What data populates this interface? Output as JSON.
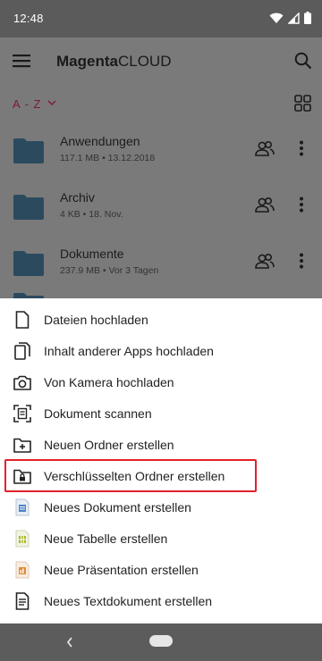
{
  "status_bar": {
    "time": "12:48"
  },
  "app_bar": {
    "title_bold": "Magenta",
    "title_rest": "CLOUD"
  },
  "sort": {
    "label": "A - Z"
  },
  "files": [
    {
      "name": "Anwendungen",
      "meta": "117.1 MB • 13.12.2018"
    },
    {
      "name": "Archiv",
      "meta": "4 KB • 18. Nov."
    },
    {
      "name": "Dokumente",
      "meta": "237.9 MB • Vor 3 Tagen"
    }
  ],
  "menu": [
    {
      "label": "Dateien hochladen",
      "icon": "file-icon"
    },
    {
      "label": "Inhalt anderer Apps hochladen",
      "icon": "copy-icon"
    },
    {
      "label": "Von Kamera hochladen",
      "icon": "camera-icon"
    },
    {
      "label": "Dokument scannen",
      "icon": "scan-icon"
    },
    {
      "label": "Neuen Ordner erstellen",
      "icon": "folder-plus-icon"
    },
    {
      "label": "Verschlüsselten Ordner erstellen",
      "icon": "folder-lock-icon"
    },
    {
      "label": "Neues Dokument erstellen",
      "icon": "document-icon"
    },
    {
      "label": "Neue Tabelle erstellen",
      "icon": "spreadsheet-icon"
    },
    {
      "label": "Neue Präsentation erstellen",
      "icon": "presentation-icon"
    },
    {
      "label": "Neues Textdokument erstellen",
      "icon": "text-document-icon"
    }
  ],
  "colors": {
    "accent": "#7d1642",
    "highlight": "#e3202b",
    "folder": "#2b4a5e"
  }
}
